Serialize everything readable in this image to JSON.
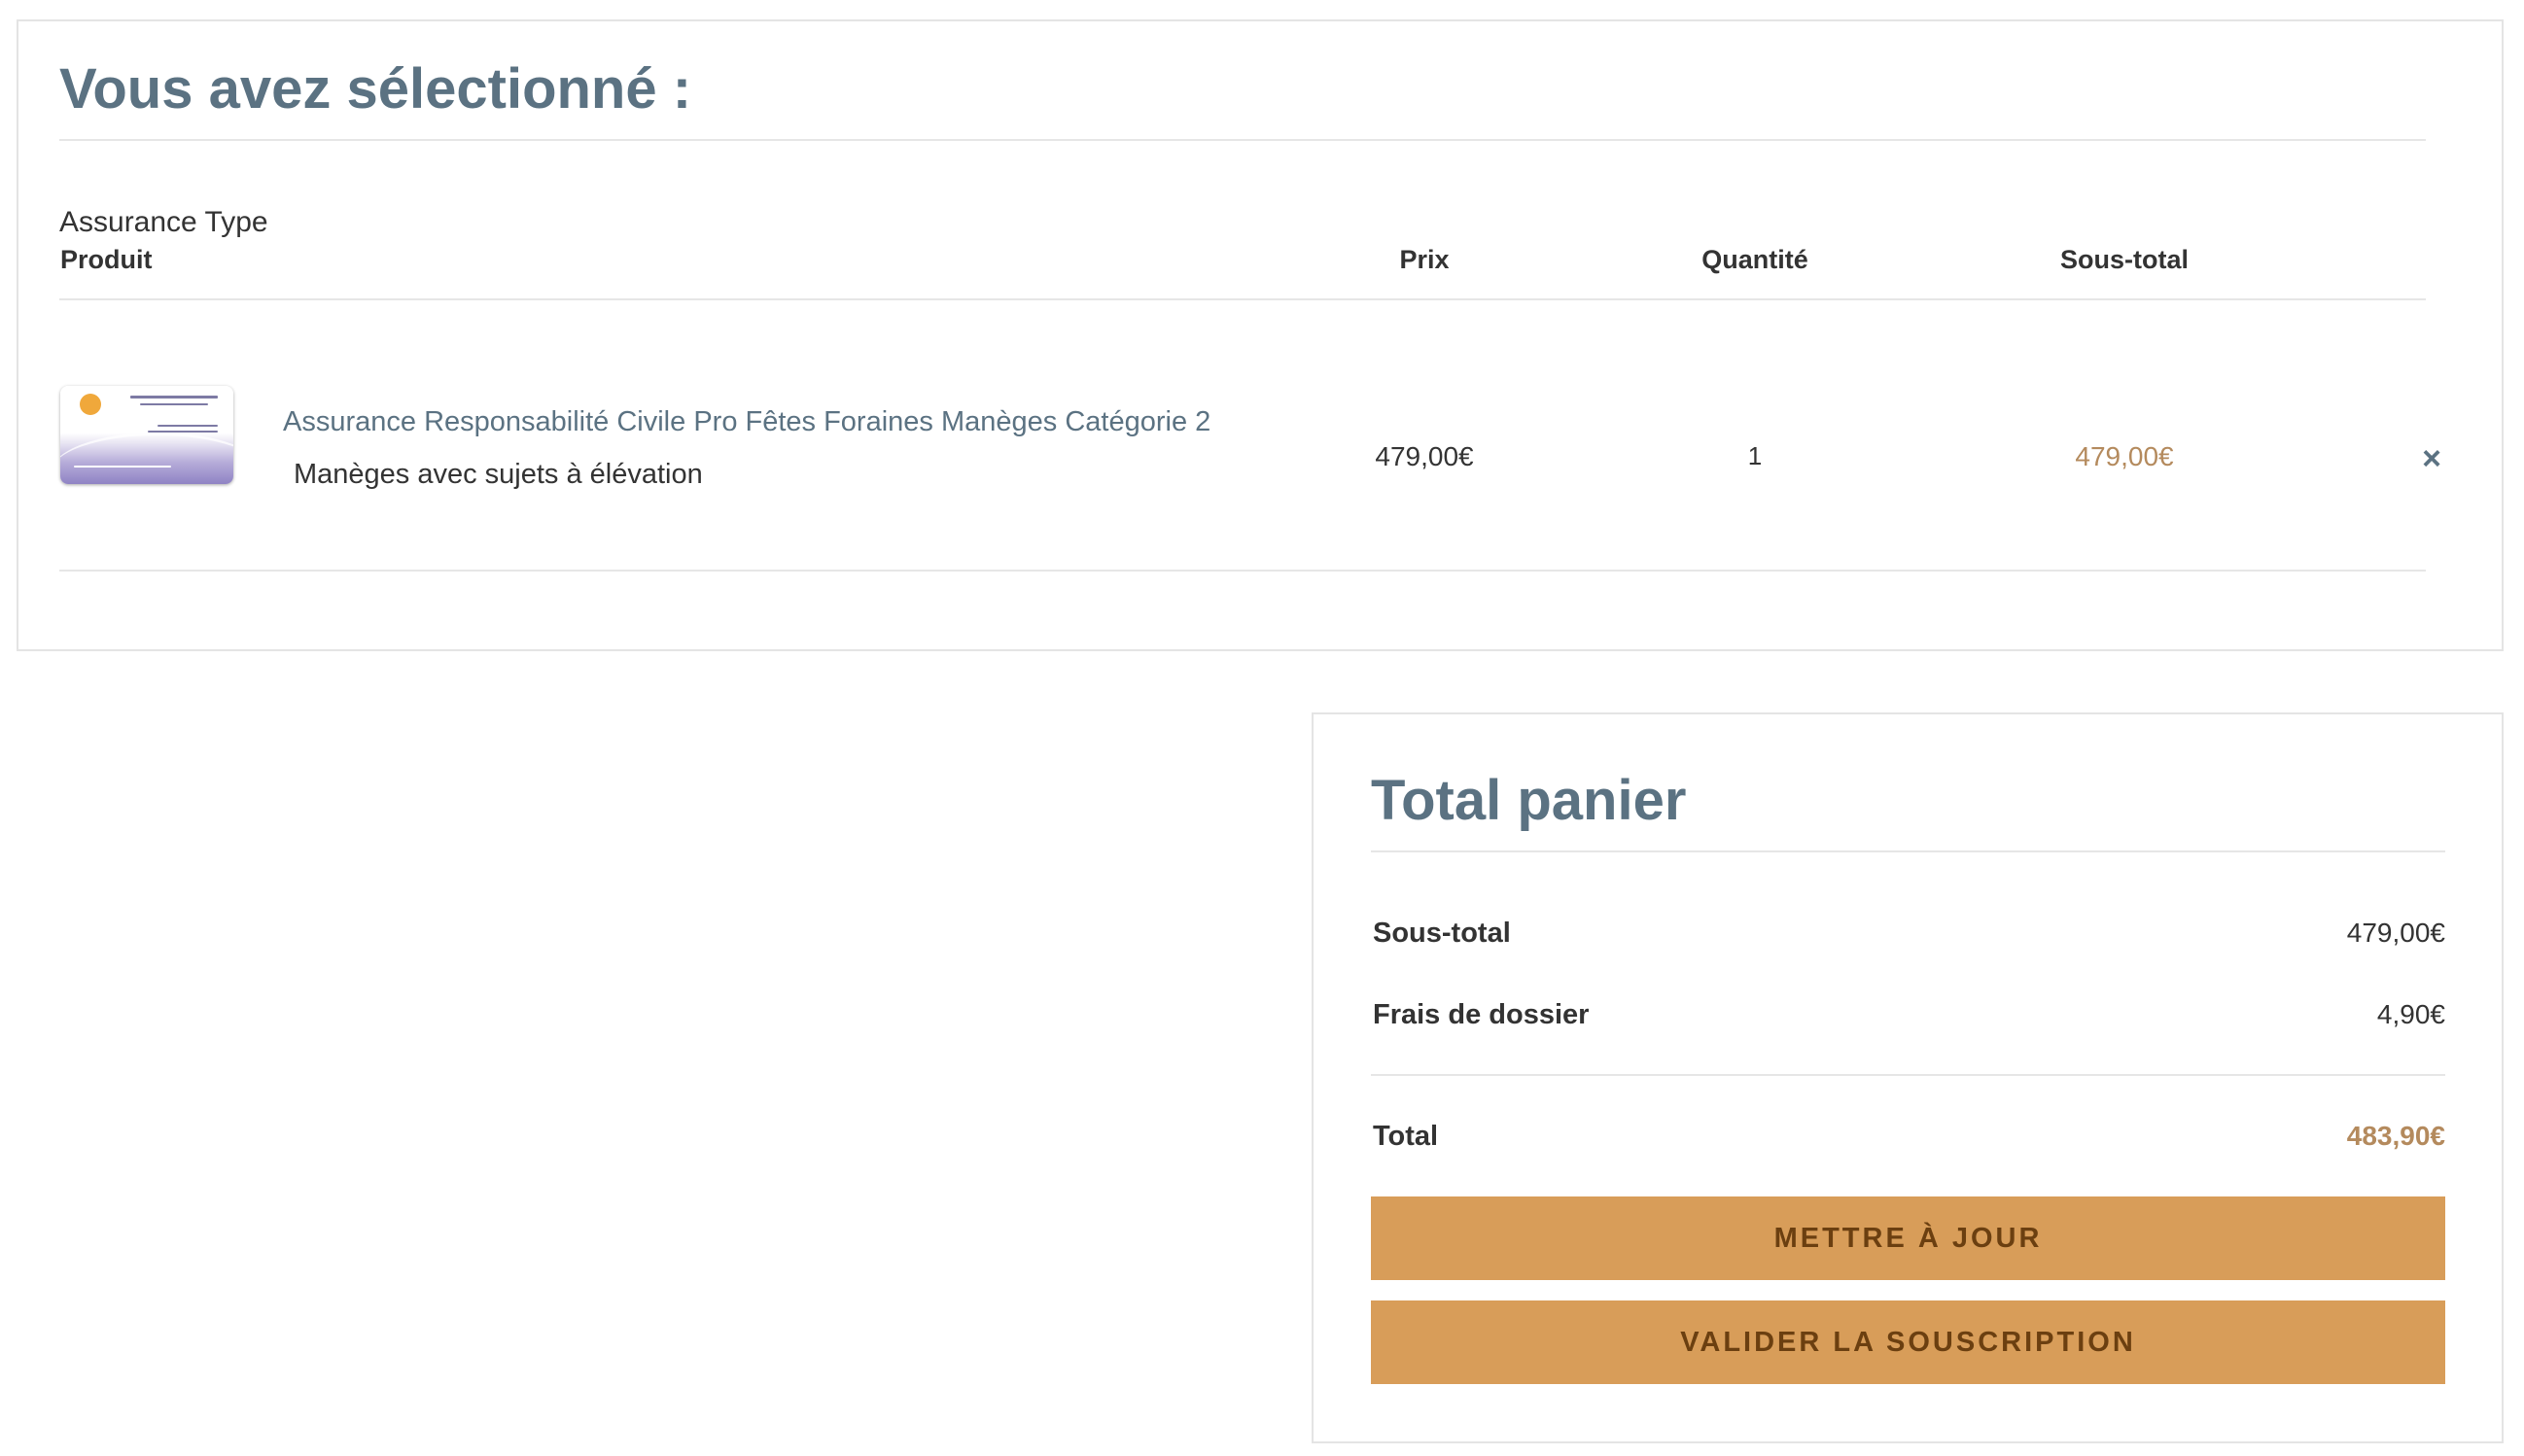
{
  "cart": {
    "title": "Vous avez sélectionné :",
    "type_label": "Assurance Type",
    "headers": {
      "product": "Produit",
      "price": "Prix",
      "quantity": "Quantité",
      "subtotal": "Sous-total"
    },
    "items": [
      {
        "name": "Assurance Responsabilité Civile Pro Fêtes Foraines Manèges Catégorie 2",
        "variant": "Manèges avec sujets à élévation",
        "price": "479,00€",
        "quantity": "1",
        "subtotal": "479,00€",
        "thumbnail_icon": "insurance-card-image",
        "remove_icon": "close-icon"
      }
    ]
  },
  "totals": {
    "title": "Total panier",
    "rows": {
      "subtotal": {
        "label": "Sous-total",
        "value": "479,00€"
      },
      "fees": {
        "label": "Frais de dossier",
        "value": "4,90€"
      },
      "total": {
        "label": "Total",
        "value": "483,90€"
      }
    },
    "buttons": {
      "update": "METTRE À JOUR",
      "validate": "VALIDER LA SOUSCRIPTION"
    }
  },
  "colors": {
    "heading": "#5b7282",
    "link": "#5b7282",
    "accent_price": "#b48a5d",
    "button_bg": "#d89d59",
    "button_text": "#6b3f10",
    "border": "#e4e4e4"
  }
}
